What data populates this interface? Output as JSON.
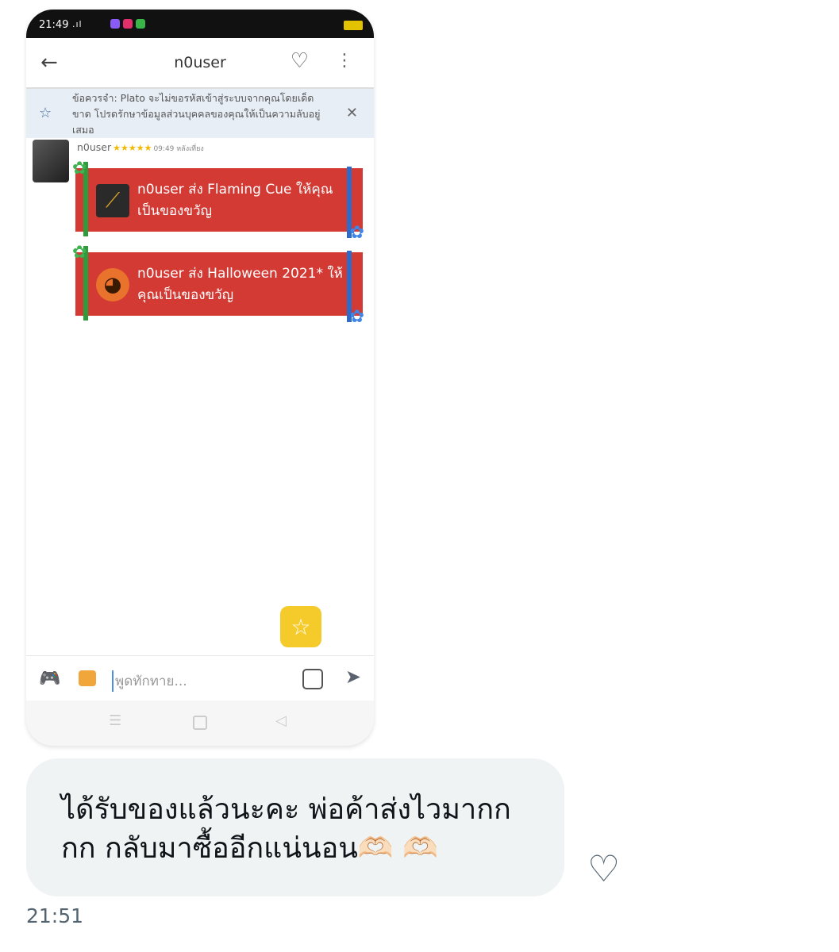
{
  "status_bar": {
    "time": "21:49",
    "signal": ".ıl",
    "battery": "90"
  },
  "header": {
    "title": "n0user"
  },
  "notice": {
    "text": "ข้อควรจำ: Plato จะไม่ขอรหัสเข้าสู่ระบบจากคุณโดยเด็ดขาด โปรดรักษาข้อมูลส่วนบุคคลของคุณให้เป็นความลับอยู่เสมอ"
  },
  "message": {
    "sender": "n0user",
    "stars": "★★★★★",
    "time": "09:49 หลังเที่ยง"
  },
  "gifts": [
    {
      "text": "n0user ส่ง Flaming Cue ให้คุณเป็นของขวัญ",
      "icon": "cue-icon"
    },
    {
      "text": "n0user ส่ง Halloween 2021* ให้คุณเป็นของขวัญ",
      "icon": "pumpkin-icon"
    }
  ],
  "composer": {
    "placeholder": "พูดทักทาย..."
  },
  "reply": {
    "text": "ได้รับของแล้วนะคะ พ่อค้าส่งไวมากกกก กลับมาซื้ออีกแน่นอน🫶🏻 🫶🏻",
    "time": "21:51"
  },
  "colors": {
    "gift_red": "#d33a34",
    "star_yellow": "#f5cb2b",
    "bubble": "#eff3f4"
  }
}
